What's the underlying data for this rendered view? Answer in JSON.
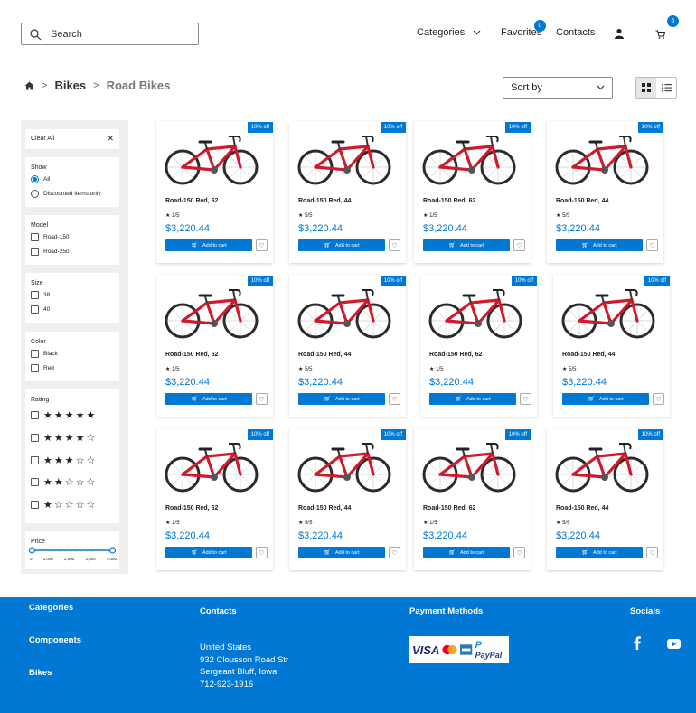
{
  "header": {
    "search_placeholder": "Search",
    "nav": {
      "categories": "Categories",
      "favorites": "Favorites",
      "contacts": "Contacts"
    },
    "favorites_count": "0",
    "cart_count": "5"
  },
  "breadcrumb": {
    "level1": "Bikes",
    "level2": "Road Bikes",
    "sep": ">"
  },
  "sort": {
    "label": "Sort by"
  },
  "filters": {
    "clear_all": "Clear All",
    "show": {
      "title": "Show",
      "options": [
        "All",
        "Discounted items only"
      ],
      "selected": "All"
    },
    "model": {
      "title": "Model",
      "options": [
        "Road-150",
        "Road-250"
      ]
    },
    "size": {
      "title": "Size",
      "options": [
        "38",
        "40"
      ]
    },
    "color": {
      "title": "Color",
      "options": [
        "Black",
        "Red"
      ]
    },
    "rating": {
      "title": "Rating",
      "options": [
        "★★★★★",
        "★★★★☆",
        "★★★☆☆",
        "★★☆☆☆",
        "★☆☆☆☆"
      ]
    },
    "price": {
      "title": "Price",
      "ticks": [
        "0",
        "1,000",
        "2,000",
        "3,000",
        "4,000"
      ]
    }
  },
  "products": [
    {
      "discount": "10% off",
      "name": "Road-150 Red, 62",
      "rating": "1/5",
      "price": "$3,220.44"
    },
    {
      "discount": "10% off",
      "name": "Road-150 Red, 44",
      "rating": "5/5",
      "price": "$3,220.44"
    },
    {
      "discount": "10% off",
      "name": "Road-150 Red, 62",
      "rating": "1/5",
      "price": "$3,220.44"
    },
    {
      "discount": "10% off",
      "name": "Road-150 Red, 44",
      "rating": "5/5",
      "price": "$3,220.44"
    },
    {
      "discount": "10% off",
      "name": "Road-150 Red, 62",
      "rating": "1/5",
      "price": "$3,220.44"
    },
    {
      "discount": "10% off",
      "name": "Road-150 Red, 44",
      "rating": "5/5",
      "price": "$3,220.44"
    },
    {
      "discount": "10% off",
      "name": "Road-150 Red, 62",
      "rating": "1/5",
      "price": "$3,220.44"
    },
    {
      "discount": "10% off",
      "name": "Road-150 Red, 44",
      "rating": "5/5",
      "price": "$3,220.44"
    },
    {
      "discount": "10% off",
      "name": "Road-150 Red, 62",
      "rating": "1/5",
      "price": "$3,220.44"
    },
    {
      "discount": "10% off",
      "name": "Road-150 Red, 44",
      "rating": "5/5",
      "price": "$3,220.44"
    },
    {
      "discount": "10% off",
      "name": "Road-150 Red, 62",
      "rating": "1/5",
      "price": "$3,220.44"
    },
    {
      "discount": "10% off",
      "name": "Road-150 Red, 44",
      "rating": "5/5",
      "price": "$3,220.44"
    }
  ],
  "add_to_cart_label": "Add to cart",
  "footer": {
    "categories_title": "Categories",
    "category_links": [
      "Components",
      "Bikes"
    ],
    "contacts_title": "Contacts",
    "address": [
      "United States",
      "932 Clousson Road Str",
      "Sergeant Bluff, Iowa",
      "712-923-1916"
    ],
    "payment_title": "Payment Methods",
    "payment_logos": {
      "visa": "VISA",
      "paypal": "PayPal"
    },
    "socials_title": "Socials"
  },
  "colors": {
    "accent": "#0078d4",
    "bike_red": "#d0192a"
  }
}
